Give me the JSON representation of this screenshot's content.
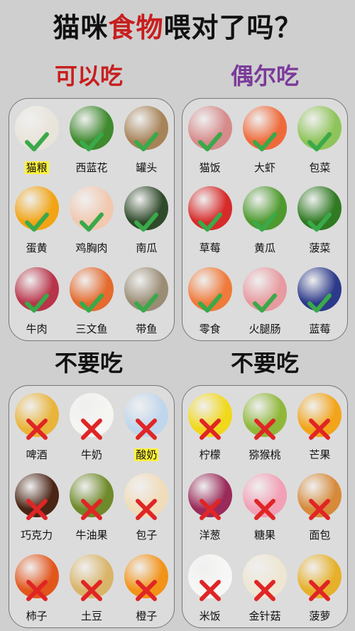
{
  "title": {
    "part1": "猫咪",
    "part2": "食物",
    "part3": "喂对了吗？"
  },
  "sections": {
    "can_eat": "可以吃",
    "sometimes": "偶尔吃",
    "no_left": "不要吃",
    "no_right": "不要吃"
  },
  "can_eat_items": [
    {
      "label": "猫粮",
      "highlight": true,
      "color": "#e9e4da",
      "icon": "cat-food-bag-icon"
    },
    {
      "label": "西蓝花",
      "color": "#3f8a2e",
      "icon": "broccoli-icon"
    },
    {
      "label": "罐头",
      "color": "#a78358",
      "icon": "canned-food-icon"
    },
    {
      "label": "蛋黄",
      "color": "#f2a414",
      "icon": "egg-yolk-icon"
    },
    {
      "label": "鸡胸肉",
      "color": "#f1c9b1",
      "icon": "chicken-breast-icon"
    },
    {
      "label": "南瓜",
      "color": "#2f4a2a",
      "icon": "pumpkin-icon"
    },
    {
      "label": "牛肉",
      "color": "#b8344a",
      "icon": "beef-icon"
    },
    {
      "label": "三文鱼",
      "color": "#e46a2d",
      "icon": "salmon-icon"
    },
    {
      "label": "带鱼",
      "color": "#9a8d75",
      "icon": "fish-icon"
    }
  ],
  "sometimes_items": [
    {
      "label": "猫饭",
      "color": "#d68b8b",
      "icon": "cat-rice-icon"
    },
    {
      "label": "大虾",
      "color": "#ef6a3a",
      "icon": "shrimp-icon"
    },
    {
      "label": "包菜",
      "color": "#8fc45a",
      "icon": "cabbage-icon"
    },
    {
      "label": "草莓",
      "color": "#d72a2a",
      "icon": "strawberry-icon"
    },
    {
      "label": "黄瓜",
      "color": "#4e9a2e",
      "icon": "cucumber-icon"
    },
    {
      "label": "菠菜",
      "color": "#2f7a22",
      "icon": "spinach-icon"
    },
    {
      "label": "零食",
      "color": "#ef7a3a",
      "icon": "snack-icon"
    },
    {
      "label": "火腿肠",
      "color": "#e79aa0",
      "icon": "ham-sausage-icon"
    },
    {
      "label": "蓝莓",
      "color": "#2c3a8a",
      "icon": "blueberry-icon"
    }
  ],
  "no_left_items": [
    {
      "label": "啤酒",
      "color": "#e9b43a",
      "icon": "beer-icon"
    },
    {
      "label": "牛奶",
      "color": "#f5f5f2",
      "icon": "milk-icon"
    },
    {
      "label": "酸奶",
      "highlight": true,
      "color": "#bfd6ec",
      "icon": "yogurt-icon"
    },
    {
      "label": "巧克力",
      "color": "#4a2414",
      "icon": "chocolate-icon"
    },
    {
      "label": "牛油果",
      "color": "#6f8a2a",
      "icon": "avocado-icon"
    },
    {
      "label": "包子",
      "color": "#f0dcb9",
      "icon": "steamed-bun-icon"
    },
    {
      "label": "柿子",
      "color": "#e2561c",
      "icon": "persimmon-icon"
    },
    {
      "label": "土豆",
      "color": "#d9b56a",
      "icon": "potato-icon"
    },
    {
      "label": "橙子",
      "color": "#f29318",
      "icon": "orange-icon"
    }
  ],
  "no_right_items": [
    {
      "label": "柠檬",
      "color": "#f1d81c",
      "icon": "lemon-icon"
    },
    {
      "label": "猕猴桃",
      "color": "#8fb83a",
      "icon": "kiwi-icon"
    },
    {
      "label": "芒果",
      "color": "#f2a41a",
      "icon": "mango-icon"
    },
    {
      "label": "洋葱",
      "color": "#9a2a5a",
      "icon": "onion-icon"
    },
    {
      "label": "糖果",
      "color": "#f2a0b6",
      "icon": "candy-icon"
    },
    {
      "label": "面包",
      "color": "#d68a3a",
      "icon": "bread-icon"
    },
    {
      "label": "米饭",
      "color": "#f7f7f5",
      "icon": "rice-icon"
    },
    {
      "label": "金针菇",
      "color": "#eee6d2",
      "icon": "enoki-mushroom-icon"
    },
    {
      "label": "菠萝",
      "color": "#e6b02a",
      "icon": "pineapple-icon"
    }
  ],
  "colors": {
    "title_red": "#c81e1e",
    "can_eat_head": "#c81e1e",
    "sometimes_head": "#7a3a9a",
    "no_head": "#111111",
    "check": "#3aa94a",
    "cross": "#e02525",
    "highlight": "#fff23a"
  }
}
